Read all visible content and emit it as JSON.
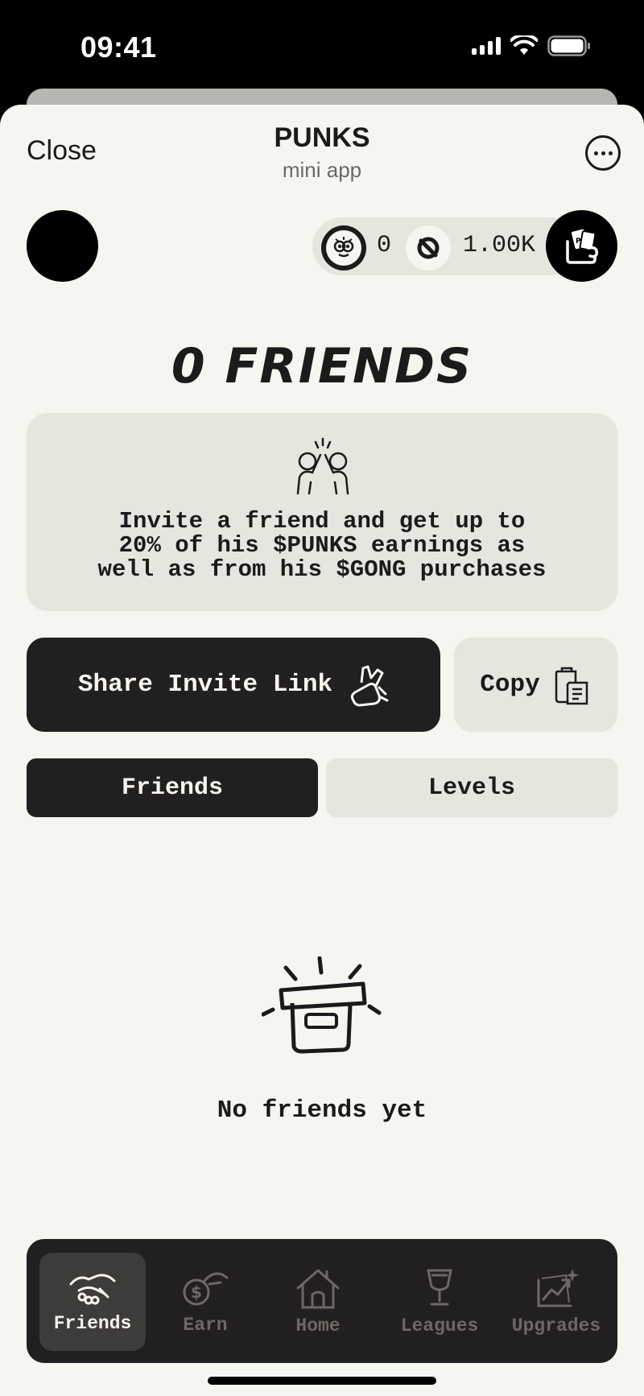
{
  "status_bar": {
    "time": "09:41"
  },
  "header": {
    "close_label": "Close",
    "title": "PUNKS",
    "subtitle": "mini app",
    "more_icon": "more-icon"
  },
  "balances": {
    "punks_balance": "0",
    "gong_balance": "1.00K",
    "punks_icon": "punk-coin-icon",
    "gong_icon": "gong-coin-icon"
  },
  "friends_count_title": "0 FRIENDS",
  "invite_card": {
    "icon": "high-five-icon",
    "text": "Invite a friend and get up to\n20% of his $PUNKS earnings as\nwell as from his $GONG purchases"
  },
  "actions": {
    "share_label": "Share Invite Link",
    "share_icon": "share-hand-icon",
    "copy_label": "Copy",
    "copy_icon": "clipboard-icon"
  },
  "tabs": [
    {
      "label": "Friends",
      "active": true
    },
    {
      "label": "Levels",
      "active": false
    }
  ],
  "empty_state": {
    "icon": "empty-box-icon",
    "text": "No friends yet"
  },
  "bottom_nav": [
    {
      "label": "Friends",
      "icon": "handshake-icon",
      "active": true
    },
    {
      "label": "Earn",
      "icon": "coin-hand-icon",
      "active": false
    },
    {
      "label": "Home",
      "icon": "home-icon",
      "active": false
    },
    {
      "label": "Leagues",
      "icon": "trophy-icon",
      "active": false
    },
    {
      "label": "Upgrades",
      "icon": "upgrade-chart-icon",
      "active": false
    }
  ],
  "colors": {
    "background": "#f6f5ef",
    "card": "#e6e5de",
    "dark": "#221f20",
    "text": "#1c1a1a"
  }
}
